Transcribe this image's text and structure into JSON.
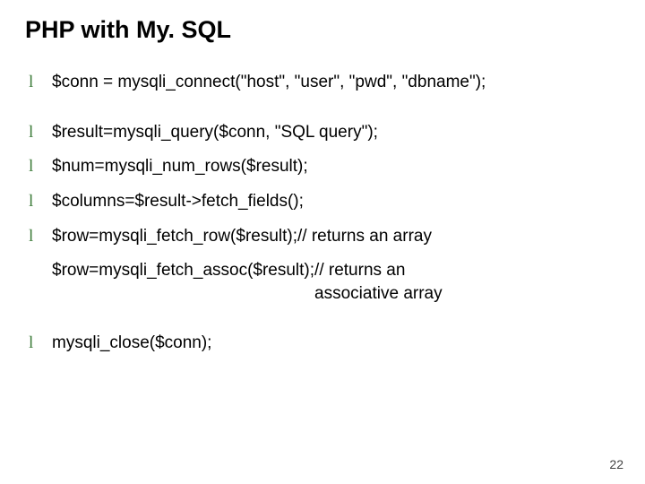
{
  "title": "PHP with My. SQL",
  "bullet_glyph": "l",
  "items": [
    {
      "text": "$conn = mysqli_connect(\"host\", \"user\", \"pwd\", \"dbname\");",
      "bullet": true,
      "gap_above": false
    },
    {
      "text": "$result=mysqli_query($conn, \"SQL query\");",
      "bullet": true,
      "gap_above": true
    },
    {
      "text": "$num=mysqli_num_rows($result);",
      "bullet": true,
      "gap_above": false
    },
    {
      "text": "$columns=$result->fetch_fields();",
      "bullet": true,
      "gap_above": false
    },
    {
      "text": "$row=mysqli_fetch_row($result);",
      "comment": "// returns an array",
      "pad": "          ",
      "bullet": true,
      "gap_above": false
    },
    {
      "text": "$row=mysqli_fetch_assoc($result);",
      "comment": "// returns an\nassociative array",
      "pad": "      ",
      "bullet": false,
      "gap_above": false
    },
    {
      "text": "mysqli_close($conn);",
      "bullet": true,
      "gap_above": true
    }
  ],
  "page_number": "22"
}
